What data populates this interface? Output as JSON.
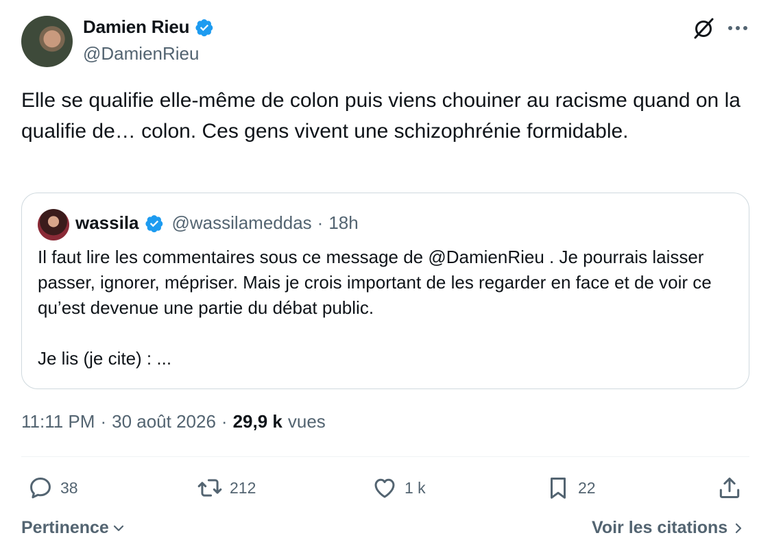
{
  "post": {
    "author": {
      "name": "Damien Rieu",
      "handle": "@DamienRieu",
      "verified": true
    },
    "text": "Elle se qualifie elle-même de colon puis viens chouiner au racisme quand on la qualifie de… colon. Ces gens vivent une schizophrénie formidable.",
    "quote": {
      "name": "wassila",
      "handle": "@wassilameddas",
      "separator": "·",
      "time": "18h",
      "verified": true,
      "paragraph_1": "Il faut lire les commentaires sous ce message de @DamienRieu . Je pourrais laisser passer, ignorer, mépriser. Mais je crois important de les regarder en face et de voir ce qu’est devenue une partie du débat public.",
      "paragraph_2": "Je lis (je cite) : ..."
    },
    "meta": {
      "time": "11:11 PM",
      "separator_1": "·",
      "date": "30 août 2026",
      "separator_2": "·",
      "views_count": "29,9 k",
      "views_label": "vues"
    },
    "actions": {
      "replies": "38",
      "reposts": "212",
      "likes": "1 k",
      "bookmarks": "22"
    },
    "footer": {
      "sort_label": "Pertinence",
      "quotes_link": "Voir les citations"
    }
  },
  "icons": {
    "verified": "verified-badge-icon",
    "grok": "grok-icon",
    "more": "more-icon",
    "reply": "reply-icon",
    "repost": "repost-icon",
    "like": "heart-icon",
    "bookmark": "bookmark-icon",
    "share": "share-icon"
  },
  "colors": {
    "verified_blue": "#1d9bf0",
    "text_primary": "#0f1419",
    "text_secondary": "#536471",
    "border": "#cfd9de"
  }
}
